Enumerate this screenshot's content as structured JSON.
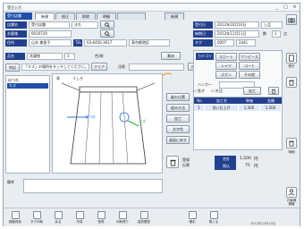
{
  "window": {
    "title": "受注入力"
  },
  "titlebar_buttons": {
    "minimize": "_",
    "maximize": "□",
    "close": "×"
  },
  "header": {
    "shop_label": "受付店舗",
    "tabs": [
      "新規",
      "修正",
      "削除",
      "明細",
      "",
      "新規"
    ]
  },
  "form": {
    "store_label": "店舗名",
    "store_value": "受付店舗",
    "store_code": "きれ",
    "customer_label": "お客様",
    "customer_code": "0010729",
    "customer_name": "山本 美香子",
    "phone_label": "TEL",
    "phone_value": "03-6450-3617",
    "address_label": "住所",
    "address_value": "東京都港区",
    "receipt_date_label": "受付日",
    "receipt_date_value": "2012年10月10日",
    "receipt_sub": "上品",
    "delivery_label": "納期日",
    "delivery_value": "2012年11月11日",
    "tag_label": "タグ",
    "tag_value": "0007",
    "tag_count": "2441",
    "count_label": "数",
    "count_value": "1",
    "unit": "点"
  },
  "item": {
    "name_label": "品名",
    "name_value": "洗濯物",
    "qty": "1",
    "color_label": "色/柄",
    "material_label": "素材",
    "note_label": "特記",
    "note_value": "「キズ」の場所をタッチしてください。",
    "clear_button": "クリア",
    "note2_label": "注釈",
    "clear2_button": "クリア"
  },
  "parts_list": {
    "items": [
      "ほつれ",
      "キズ"
    ],
    "selected": "キズ"
  },
  "diagram": {
    "tab_front": "表",
    "tab_back": "うしろ",
    "annotation": "ほつれ",
    "annotation2": "キズ"
  },
  "side_buttons": [
    "破れ位置",
    "組み方法",
    "加工",
    "文字色",
    "画面に戻す"
  ],
  "right_panel": {
    "category_label": "カテゴリ",
    "category_tabs": [
      "スカート",
      "ワンピース",
      "シャツ",
      "コート",
      "ズボン",
      "その他"
    ],
    "hanger_label": "ハンガー",
    "quick_label": "急ぎ",
    "outside_label": "外注",
    "process_button": "加工",
    "table_headers": [
      "No",
      "加工名",
      "単価",
      "金額"
    ],
    "rows": [
      {
        "no": "1",
        "name": "洗い仕上げ",
        "price": "1,500",
        "amount": "1,500"
      }
    ]
  },
  "summary": {
    "subtotal_label": "合計",
    "tax_label": "税込",
    "subtotal_value": "1,500",
    "tax_value": "75",
    "currency": "円",
    "register_label": "登録",
    "register_sub": "伝票"
  },
  "remarks_label": "備考",
  "footer_keys": [
    "顧客検索",
    "タグ印刷",
    "戻る",
    "写真",
    "登録",
    "印刷預り",
    "直前履歴",
    "",
    "確定",
    "閉じる"
  ],
  "status": {
    "right_text": "2012年10月10日"
  },
  "right_icons": {
    "order_btn": "受付",
    "cart_label": "明細",
    "info_btn": "お客様",
    "info_sub": "情報"
  },
  "colors": {
    "accent": "#1f4fa8",
    "header_blue": "#23408e",
    "positive": "#2aa84a",
    "alert": "#d8232a"
  }
}
